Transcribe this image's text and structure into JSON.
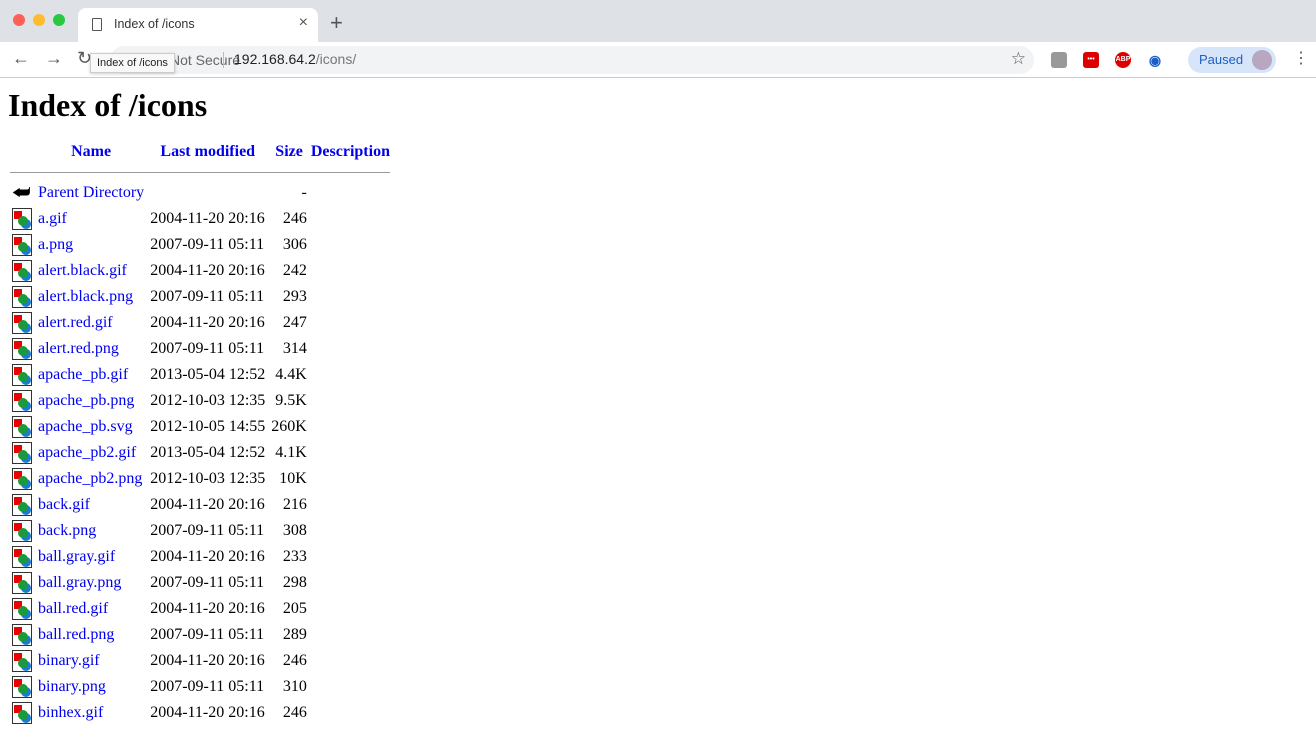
{
  "browser": {
    "tab_title": "Index of /icons",
    "tooltip": "Index of /icons",
    "security_label": "Not Secure",
    "url_host": "192.168.64.2",
    "url_path": "/icons/",
    "profile_label": "Paused",
    "extensions": [
      "extension-icon",
      "lastpass-icon",
      "adblock-plus-icon",
      "eye-icon"
    ],
    "ext_abp": "ABP"
  },
  "page": {
    "title": "Index of /icons",
    "columns": {
      "name": "Name",
      "modified": "Last modified",
      "size": "Size",
      "description": "Description"
    },
    "parent": {
      "name": "Parent Directory",
      "size": "-"
    },
    "rows": [
      {
        "name": "a.gif",
        "modified": "2004-11-20 20:16",
        "size": "246"
      },
      {
        "name": "a.png",
        "modified": "2007-09-11 05:11",
        "size": "306"
      },
      {
        "name": "alert.black.gif",
        "modified": "2004-11-20 20:16",
        "size": "242"
      },
      {
        "name": "alert.black.png",
        "modified": "2007-09-11 05:11",
        "size": "293"
      },
      {
        "name": "alert.red.gif",
        "modified": "2004-11-20 20:16",
        "size": "247"
      },
      {
        "name": "alert.red.png",
        "modified": "2007-09-11 05:11",
        "size": "314"
      },
      {
        "name": "apache_pb.gif",
        "modified": "2013-05-04 12:52",
        "size": "4.4K"
      },
      {
        "name": "apache_pb.png",
        "modified": "2012-10-03 12:35",
        "size": "9.5K"
      },
      {
        "name": "apache_pb.svg",
        "modified": "2012-10-05 14:55",
        "size": "260K"
      },
      {
        "name": "apache_pb2.gif",
        "modified": "2013-05-04 12:52",
        "size": "4.1K"
      },
      {
        "name": "apache_pb2.png",
        "modified": "2012-10-03 12:35",
        "size": "10K"
      },
      {
        "name": "back.gif",
        "modified": "2004-11-20 20:16",
        "size": "216"
      },
      {
        "name": "back.png",
        "modified": "2007-09-11 05:11",
        "size": "308"
      },
      {
        "name": "ball.gray.gif",
        "modified": "2004-11-20 20:16",
        "size": "233"
      },
      {
        "name": "ball.gray.png",
        "modified": "2007-09-11 05:11",
        "size": "298"
      },
      {
        "name": "ball.red.gif",
        "modified": "2004-11-20 20:16",
        "size": "205"
      },
      {
        "name": "ball.red.png",
        "modified": "2007-09-11 05:11",
        "size": "289"
      },
      {
        "name": "binary.gif",
        "modified": "2004-11-20 20:16",
        "size": "246"
      },
      {
        "name": "binary.png",
        "modified": "2007-09-11 05:11",
        "size": "310"
      },
      {
        "name": "binhex.gif",
        "modified": "2004-11-20 20:16",
        "size": "246"
      }
    ]
  }
}
